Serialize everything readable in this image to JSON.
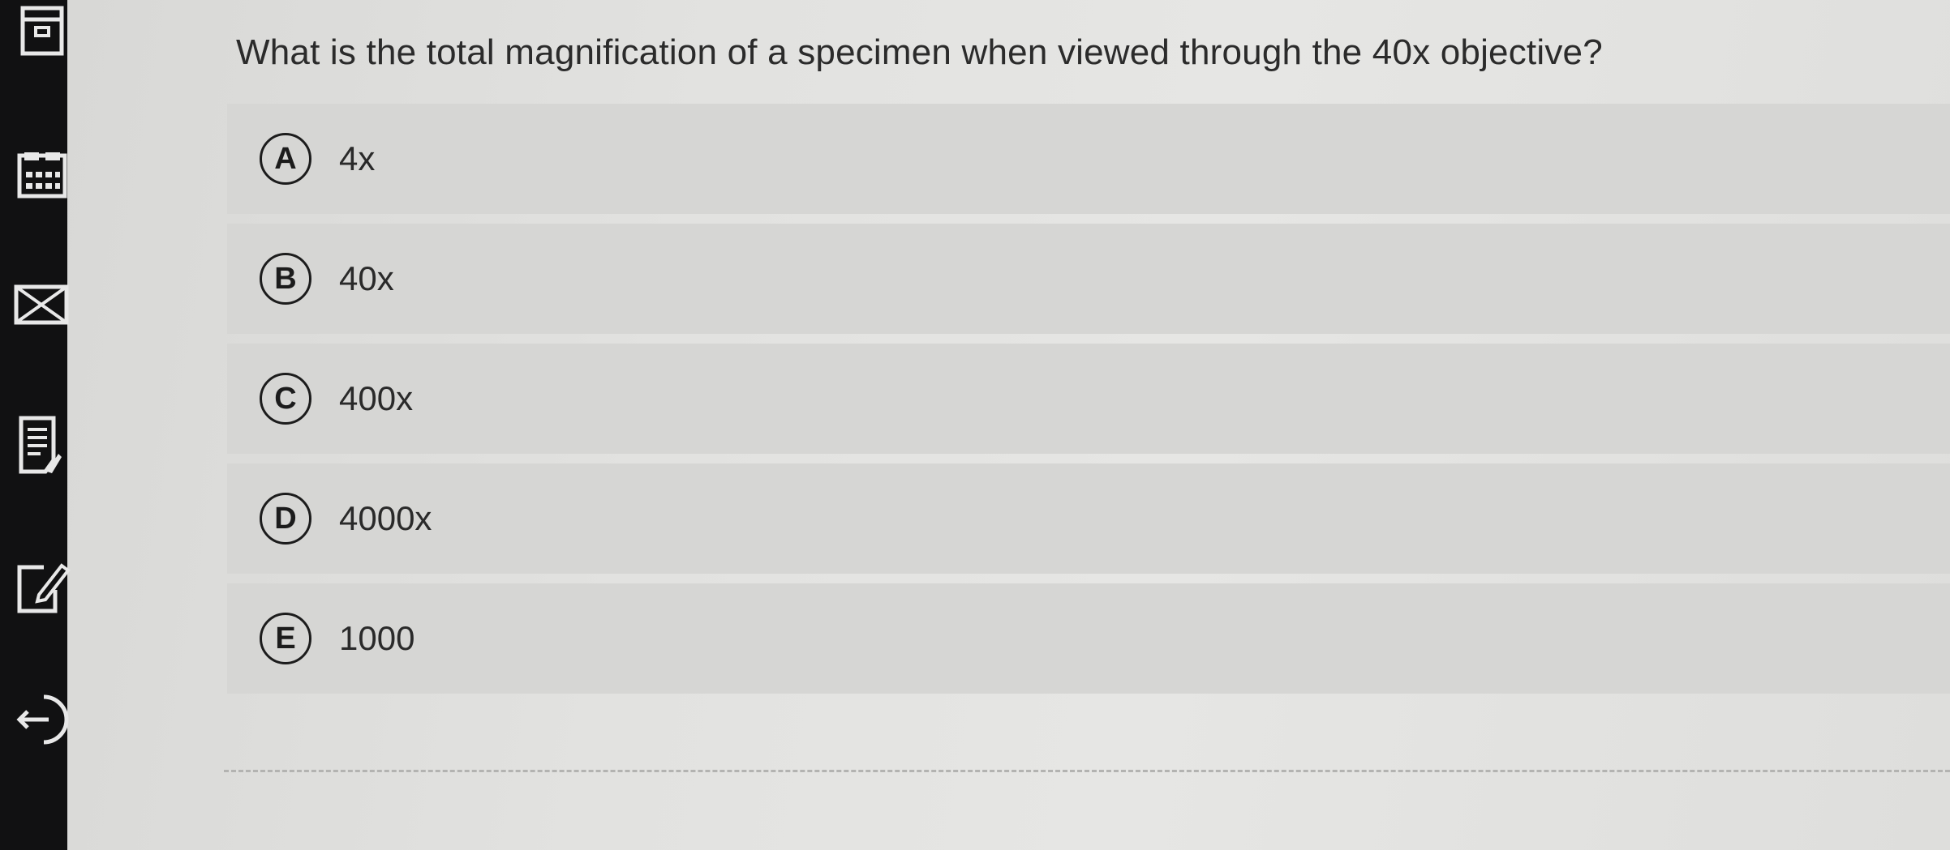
{
  "question": {
    "text": "What is the total magnification of a specimen when viewed through the 40x objective?"
  },
  "answers": [
    {
      "letter": "A",
      "text": "4x"
    },
    {
      "letter": "B",
      "text": "40x"
    },
    {
      "letter": "C",
      "text": "400x"
    },
    {
      "letter": "D",
      "text": "4000x"
    },
    {
      "letter": "E",
      "text": "1000"
    }
  ],
  "toolbar": {
    "icons": [
      "panel-icon",
      "calculator-icon",
      "mail-icon",
      "notes-icon",
      "edit-icon",
      "exit-icon"
    ]
  },
  "colors": {
    "sidebar": "#111112",
    "answer_bg": "#d6d6d4",
    "text": "#2b2b2b"
  }
}
